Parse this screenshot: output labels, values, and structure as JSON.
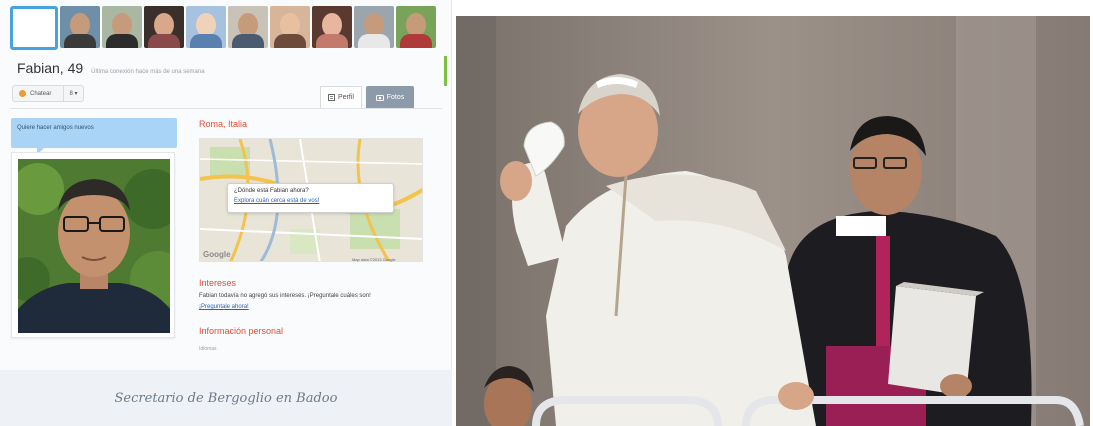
{
  "profile": {
    "name_age": "Fabian, 49",
    "last_connection": "Última conexión hace más de una semana",
    "chat_label": "Chatear",
    "more_label": "8 ▾",
    "tab_profile": "Perfil",
    "tab_photos": "Fotos",
    "status_bubble": "Quiere hacer amigos nuevos",
    "location_title": "Roma, Italia",
    "map_question": "¿Dónde está Fabian ahora?",
    "map_link": "Explora cuán cerca está de vos!",
    "map_brand": "Google",
    "map_footer": "Map data ©2013 Google",
    "interests_title": "Intereses",
    "interests_text": "Fabian todavía no agregó sus intereses. ¡Preguntale cuáles son!",
    "ask_link": "¡Preguntale ahora!",
    "personal_info_title": "Información personal",
    "personal_info_sub": "Idiomas"
  },
  "caption": "Secretario de Bergoglio en Badoo",
  "colors": {
    "accent_blue": "#47a3e0",
    "section_red": "#e34d36",
    "bubble_blue": "#a9d4f5",
    "tab_active": "#8d9aa9"
  },
  "icons": [
    "chat-dot-icon",
    "profile-icon",
    "camera-icon"
  ]
}
